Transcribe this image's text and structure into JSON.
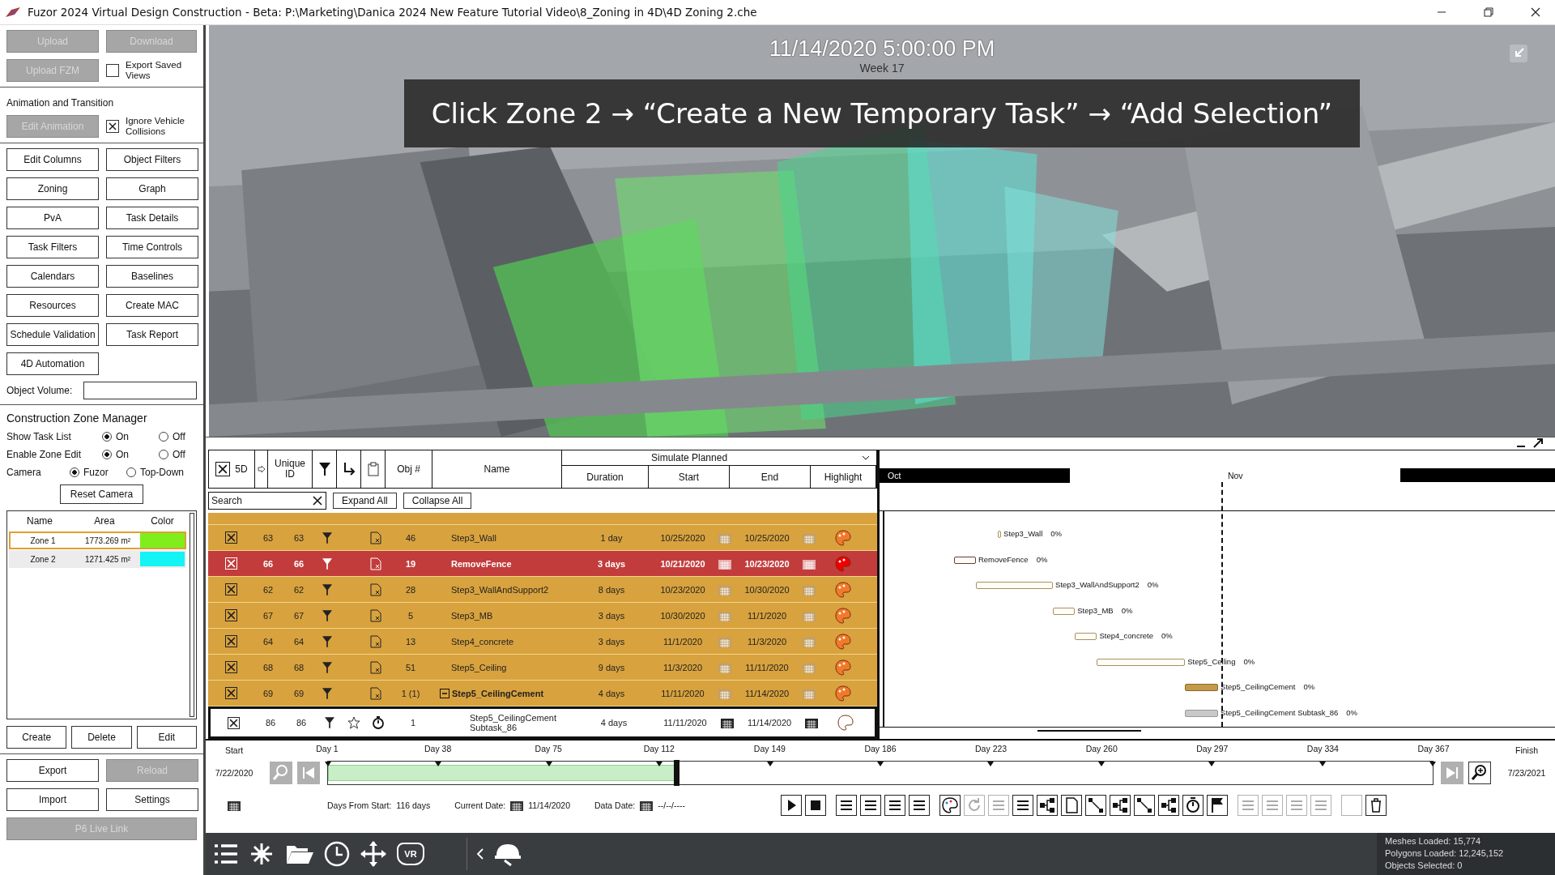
{
  "window": {
    "title": "Fuzor 2024 Virtual Design Construction - Beta: P:\\Marketing\\Danica 2024 New Feature Tutorial Video\\8_Zoning in 4D\\4D Zoning 2.che"
  },
  "left_panel": {
    "top_buttons": [
      {
        "label": "Upload",
        "disabled": true
      },
      {
        "label": "Download",
        "disabled": true
      }
    ],
    "upload_fzm": {
      "label": "Upload FZM",
      "disabled": true
    },
    "export_saved_views": {
      "label": "Export Saved Views",
      "checked": false
    },
    "animation_heading": "Animation and Transition",
    "edit_animation": {
      "label": "Edit Animation",
      "disabled": true
    },
    "ignore_vehicle": {
      "label": "Ignore Vehicle Collisions",
      "checked": true
    },
    "tool_buttons": [
      "Edit Columns",
      "Object Filters",
      "Zoning",
      "Graph",
      "PvA",
      "Task Details",
      "Task Filters",
      "Time Controls",
      "Calendars",
      "Baselines",
      "Resources",
      "Create MAC",
      "Schedule Validation",
      "Task Report",
      "4D Automation"
    ],
    "object_volume": {
      "label": "Object Volume:"
    },
    "zone_manager": {
      "heading": "Construction Zone Manager",
      "settings": [
        {
          "label": "Show Task List",
          "options": [
            {
              "label": "On",
              "selected": true
            },
            {
              "label": "Off",
              "selected": false
            }
          ]
        },
        {
          "label": "Enable Zone Edit",
          "options": [
            {
              "label": "On",
              "selected": true
            },
            {
              "label": "Off",
              "selected": false
            }
          ]
        },
        {
          "label": "Camera",
          "options": [
            {
              "label": "Fuzor",
              "selected": true
            },
            {
              "label": "Top-Down",
              "selected": false
            }
          ]
        }
      ],
      "reset_camera": "Reset Camera",
      "zone_table": {
        "columns": [
          "Name",
          "Area",
          "Color"
        ],
        "rows": [
          {
            "name": "Zone 1",
            "area": "1773.269 m²",
            "color": "#80ee1c",
            "selected": true
          },
          {
            "name": "Zone 2",
            "area": "1271.425 m²",
            "color": "#14f4f4",
            "selected": false
          }
        ]
      },
      "actions": [
        "Create",
        "Delete",
        "Edit"
      ]
    },
    "bottom_buttons": [
      {
        "label": "Export",
        "disabled": false
      },
      {
        "label": "Reload",
        "disabled": true
      },
      {
        "label": "Import",
        "disabled": false
      },
      {
        "label": "Settings",
        "disabled": false
      }
    ],
    "live_link": {
      "label": "P6 Live Link",
      "disabled": true
    }
  },
  "viewport": {
    "datetime": "11/14/2020 5:00:00 PM",
    "week": "Week 17",
    "caption": "Click Zone 2 → “Create a New Temporary Task” → “Add Selection”"
  },
  "tasks": {
    "header": {
      "all_checked": true,
      "first": "5D",
      "unique_id": "Unique ID",
      "obj": "Obj #",
      "name": "Name",
      "mode": "Simulate Planned",
      "columns": [
        "Duration",
        "Start",
        "End",
        "Highlight"
      ]
    },
    "search": {
      "placeholder": "Search"
    },
    "expand_all": "Expand All",
    "collapse_all": "Collapse All",
    "rows": [
      {
        "kind": "task",
        "selected": false,
        "checked": true,
        "id": "63",
        "unique_id": "63",
        "obj": "46",
        "name": "Step3_Wall",
        "duration": "1 day",
        "start": "10/25/2020",
        "end": "10/25/2020"
      },
      {
        "kind": "task",
        "selected": true,
        "checked": true,
        "id": "66",
        "unique_id": "66",
        "obj": "19",
        "name": "RemoveFence",
        "duration": "3 days",
        "start": "10/21/2020",
        "end": "10/23/2020"
      },
      {
        "kind": "task",
        "selected": false,
        "checked": true,
        "id": "62",
        "unique_id": "62",
        "obj": "28",
        "name": "Step3_WallAndSupport2",
        "duration": "8 days",
        "start": "10/23/2020",
        "end": "10/30/2020"
      },
      {
        "kind": "task",
        "selected": false,
        "checked": true,
        "id": "67",
        "unique_id": "67",
        "obj": "5",
        "name": "Step3_MB",
        "duration": "3 days",
        "start": "10/30/2020",
        "end": "11/1/2020"
      },
      {
        "kind": "task",
        "selected": false,
        "checked": true,
        "id": "64",
        "unique_id": "64",
        "obj": "13",
        "name": "Step4_concrete",
        "duration": "3 days",
        "start": "11/1/2020",
        "end": "11/3/2020"
      },
      {
        "kind": "task",
        "selected": false,
        "checked": true,
        "id": "68",
        "unique_id": "68",
        "obj": "51",
        "name": "Step5_Ceiling",
        "duration": "9 days",
        "start": "11/3/2020",
        "end": "11/11/2020"
      },
      {
        "kind": "summary",
        "selected": false,
        "checked": true,
        "id": "69",
        "unique_id": "69",
        "obj": "1 (1)",
        "name": "Step5_CeilingCement",
        "duration": "4 days",
        "start": "11/11/2020",
        "end": "11/14/2020"
      },
      {
        "kind": "subtask",
        "selected": false,
        "checked": true,
        "id": "86",
        "unique_id": "86",
        "obj": "1",
        "name": "Step5_CeilingCement Subtask_86",
        "duration": "4 days",
        "start": "11/11/2020",
        "end": "11/14/2020"
      }
    ]
  },
  "gantt": {
    "months": [
      {
        "label": "Oct",
        "dark": true
      },
      {
        "label": "Nov",
        "dark": false
      }
    ],
    "bars": [
      {
        "label": "Step3_Wall",
        "progress": "0%"
      },
      {
        "label": "RemoveFence",
        "progress": "0%"
      },
      {
        "label": "Step3_WallAndSupport2",
        "progress": "0%"
      },
      {
        "label": "Step3_MB",
        "progress": "0%"
      },
      {
        "label": "Step4_concrete",
        "progress": "0%"
      },
      {
        "label": "Step5_Ceiling",
        "progress": "0%"
      },
      {
        "label": "Step5_CeilingCement",
        "progress": "0%"
      },
      {
        "label": "Step5_CeilingCement Subtask_86",
        "progress": "0%"
      }
    ]
  },
  "timeline": {
    "start_label": "Start",
    "finish_label": "Finish",
    "start_date": "7/22/2020",
    "finish_date": "7/23/2021",
    "ticks": [
      "Day 1",
      "Day 38",
      "Day 75",
      "Day 112",
      "Day 149",
      "Day 186",
      "Day 223",
      "Day 260",
      "Day 297",
      "Day 334",
      "Day 367"
    ],
    "level": 0.315,
    "days_from_start_label": "Days From Start:",
    "days_from_start": "116 days",
    "current_date_label": "Current Date:",
    "current_date": "11/14/2020",
    "data_date_label": "Data Date:",
    "data_date": "--/--/----",
    "tools": [
      {
        "kind": "play",
        "disabled": false
      },
      {
        "kind": "stop",
        "disabled": false
      },
      {
        "kind": "list",
        "disabled": false
      },
      {
        "kind": "list",
        "disabled": false
      },
      {
        "kind": "list",
        "disabled": false
      },
      {
        "kind": "list",
        "disabled": false
      },
      {
        "kind": "palette",
        "disabled": false
      },
      {
        "kind": "refresh",
        "disabled": true
      },
      {
        "kind": "list",
        "disabled": true
      },
      {
        "kind": "list",
        "disabled": false
      },
      {
        "kind": "tree",
        "disabled": false
      },
      {
        "kind": "document",
        "disabled": false
      },
      {
        "kind": "nodes",
        "disabled": false
      },
      {
        "kind": "tree",
        "disabled": false
      },
      {
        "kind": "nodes",
        "disabled": false
      },
      {
        "kind": "tree",
        "disabled": false
      },
      {
        "kind": "stopwatch",
        "disabled": false
      },
      {
        "kind": "flag",
        "disabled": false
      },
      {
        "kind": "list",
        "disabled": true
      },
      {
        "kind": "list",
        "disabled": true
      },
      {
        "kind": "list",
        "disabled": true
      },
      {
        "kind": "list",
        "disabled": true
      },
      {
        "kind": "blank",
        "disabled": true
      },
      {
        "kind": "trash",
        "disabled": false
      }
    ]
  },
  "bottom_bar": {
    "vr_label": "VR",
    "status": [
      "Meshes Loaded: 15,774",
      "Polygons Loaded: 12,245,152",
      "Objects Selected: 0"
    ]
  }
}
